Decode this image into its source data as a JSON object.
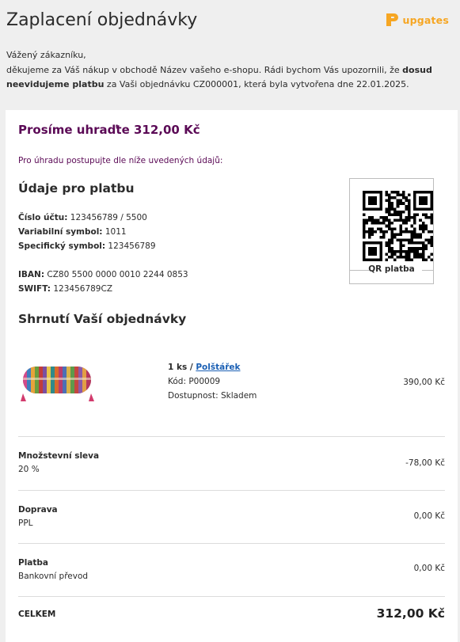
{
  "header": {
    "title": "Zaplacení objednávky",
    "logo_text": "upgates",
    "logo_icon": "upgates-logo-icon",
    "brand_color": "#f6a623"
  },
  "intro": {
    "greeting": "Vážený zákazníku,",
    "text_1": "děkujeme za Váš nákup v obchodě Název vašeho e-shopu. Rádi bychom Vás upozornili, že ",
    "bold": "dosud neevidujeme platbu",
    "text_2": " za Vaši objednávku CZ000001, která byla vytvořena dne 22.01.2025."
  },
  "payment": {
    "title": "Prosíme uhraďte 312,00 Kč",
    "subtitle": "Pro úhradu postupujte dle níže uvedených údajů:",
    "accent_color": "#5b0a56",
    "section_title": "Údaje pro platbu",
    "fields": [
      {
        "label": "Číslo účtu:",
        "value": "123456789 / 5500"
      },
      {
        "label": "Variabilní symbol:",
        "value": "1011"
      },
      {
        "label": "Specifický symbol:",
        "value": "123456789"
      }
    ],
    "iban_label": "IBAN:",
    "iban_value": "CZ80 5500 0000 0010 2244 0853",
    "swift_label": "SWIFT:",
    "swift_value": "123456789CZ",
    "qr_label": "QR platba"
  },
  "summary": {
    "title": "Shrnutí Vaší objednávky",
    "product": {
      "qty": "1 ks / ",
      "name": "Polštářek",
      "code": "Kód: P00009",
      "availability": "Dostupnost: Skladem",
      "price": "390,00 Kč",
      "image_icon": "pillow-image"
    },
    "rows": [
      {
        "label": "Množstevní sleva",
        "detail": "20 %",
        "value": "-78,00 Kč"
      },
      {
        "label": "Doprava",
        "detail": "PPL",
        "value": "0,00 Kč"
      },
      {
        "label": "Platba",
        "detail": "Bankovní převod",
        "value": "0,00 Kč"
      }
    ],
    "total_label": "CELKEM",
    "total_value": "312,00 Kč"
  }
}
